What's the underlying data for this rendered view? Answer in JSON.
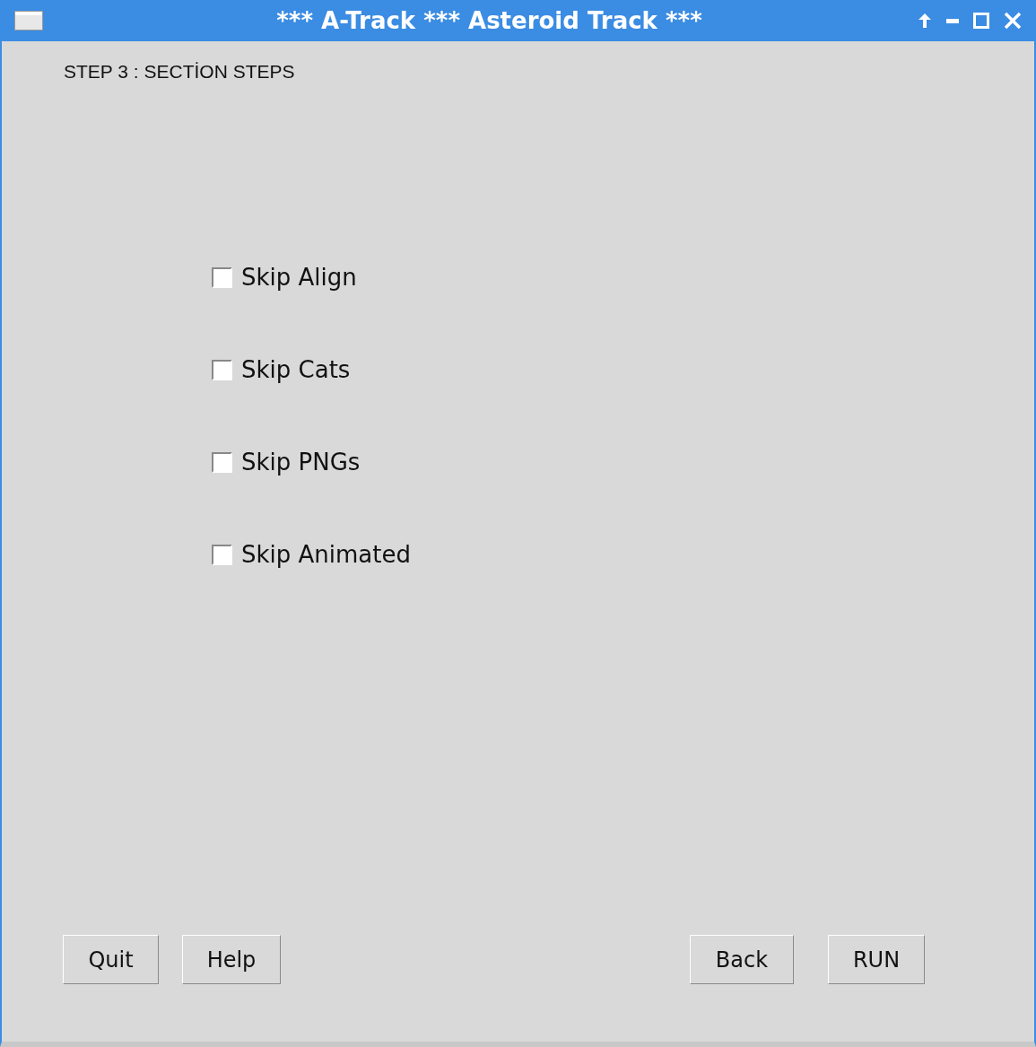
{
  "window": {
    "title": "*** A-Track *** Asteroid Track ***"
  },
  "step_label": "STEP 3 : SECTİON STEPS",
  "options": [
    {
      "label": "Skip Align",
      "checked": false
    },
    {
      "label": "Skip Cats",
      "checked": false
    },
    {
      "label": "Skip PNGs",
      "checked": false
    },
    {
      "label": "Skip Animated",
      "checked": false
    }
  ],
  "left_buttons": [
    "Quit",
    "Help"
  ],
  "right_buttons": [
    "Back",
    "RUN"
  ]
}
